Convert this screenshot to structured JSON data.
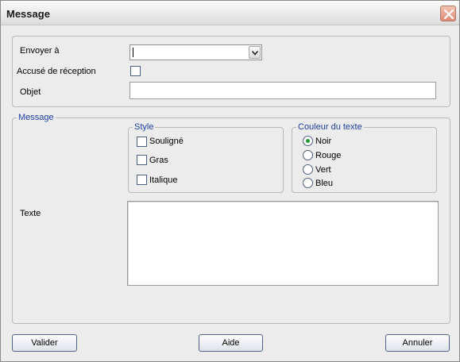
{
  "window": {
    "title": "Message"
  },
  "header_form": {
    "recipient_label": "Envoyer à",
    "recipient_value": "",
    "receipt_label": "Accusé de réception",
    "receipt_checked": false,
    "subject_label": "Objet",
    "subject_value": ""
  },
  "message_group": {
    "legend": "Message",
    "style_group": {
      "legend": "Style",
      "options": [
        {
          "label": "Souligné",
          "checked": false
        },
        {
          "label": "Gras",
          "checked": false
        },
        {
          "label": "Italique",
          "checked": false
        }
      ]
    },
    "color_group": {
      "legend": "Couleur du texte",
      "options": [
        {
          "label": "Noir",
          "selected": true
        },
        {
          "label": "Rouge",
          "selected": false
        },
        {
          "label": "Vert",
          "selected": false
        },
        {
          "label": "Bleu",
          "selected": false
        }
      ]
    },
    "text_label": "Texte",
    "text_value": ""
  },
  "buttons": {
    "ok": "Valider",
    "help": "Aide",
    "cancel": "Annuler"
  },
  "icons": {
    "close": "close-icon",
    "dropdown": "chevron-down-icon"
  },
  "colors": {
    "legend_text": "#1b3fa0",
    "close_button": "#de8b72",
    "radio_selected": "#1e9a2a"
  }
}
